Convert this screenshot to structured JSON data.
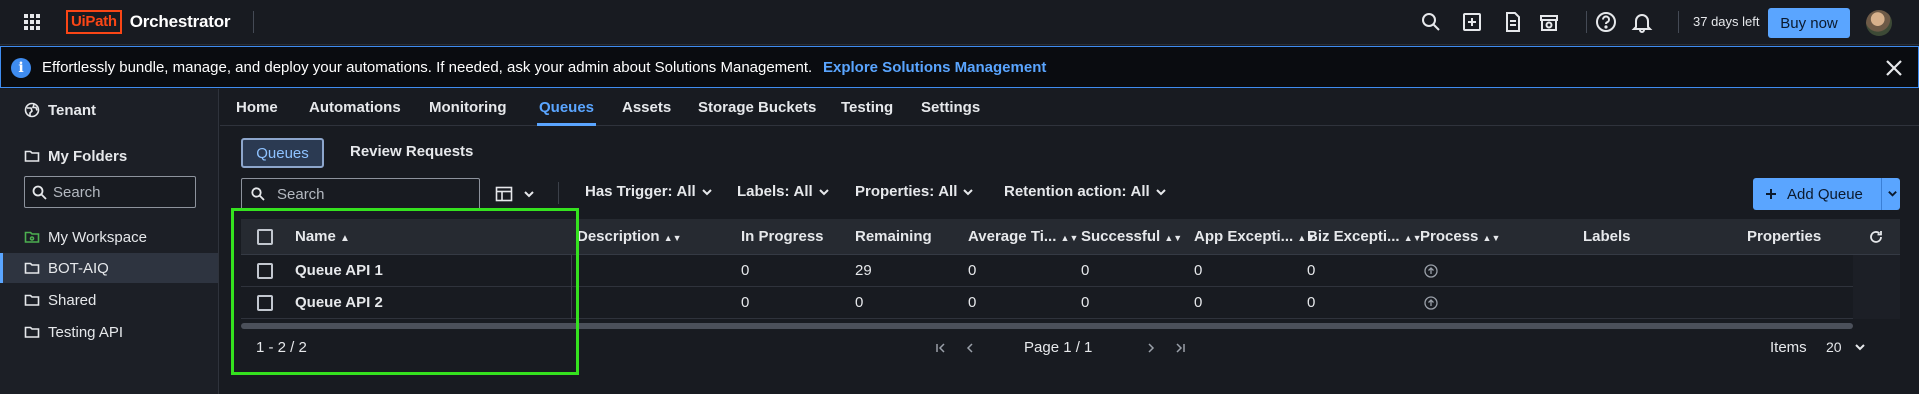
{
  "header": {
    "brand_box": "UiPath",
    "brand_name": "Orchestrator",
    "trial_text": "37 days left",
    "buy_label": "Buy now",
    "icons": [
      "apps-grid-icon",
      "search-icon",
      "add-box-icon",
      "document-icon",
      "store-icon",
      "help-icon",
      "bell-icon"
    ]
  },
  "banner": {
    "message": "Effortlessly bundle, manage, and deploy your automations. If needed, ask your admin about Solutions Management.",
    "link": "Explore Solutions Management"
  },
  "sidebar": {
    "tenant_label": "Tenant",
    "my_folders_label": "My Folders",
    "search_placeholder": "Search",
    "items": [
      {
        "label": "My Workspace",
        "icon": "workspace-folder-icon",
        "color": "#4caf50"
      },
      {
        "label": "BOT-AIQ",
        "icon": "folder-icon",
        "selected": true
      },
      {
        "label": "Shared",
        "icon": "folder-icon"
      },
      {
        "label": "Testing API",
        "icon": "folder-icon"
      }
    ]
  },
  "nav": {
    "tabs": [
      "Home",
      "Automations",
      "Monitoring",
      "Queues",
      "Assets",
      "Storage Buckets",
      "Testing",
      "Settings"
    ],
    "active": "Queues"
  },
  "subtabs": [
    "Queues",
    "Review Requests"
  ],
  "filters": {
    "search_placeholder": "Search",
    "items": [
      {
        "label": "Has Trigger:",
        "value": "All"
      },
      {
        "label": "Labels:",
        "value": "All"
      },
      {
        "label": "Properties:",
        "value": "All"
      },
      {
        "label": "Retention action:",
        "value": "All"
      }
    ],
    "add_button": "Add Queue"
  },
  "table": {
    "columns": [
      "Name",
      "Description",
      "In Progress",
      "Remaining",
      "Average Ti...",
      "Successful",
      "App Excepti...",
      "Biz Excepti...",
      "Process",
      "Labels",
      "Properties"
    ],
    "rows": [
      {
        "name": "Queue API 1",
        "description": "",
        "in_progress": "0",
        "remaining": "29",
        "average_time": "0",
        "successful": "0",
        "app_exceptions": "0",
        "biz_exceptions": "0"
      },
      {
        "name": "Queue API 2",
        "description": "",
        "in_progress": "0",
        "remaining": "0",
        "average_time": "0",
        "successful": "0",
        "app_exceptions": "0",
        "biz_exceptions": "0"
      }
    ]
  },
  "pager": {
    "range": "1 - 2 / 2",
    "page": "Page 1 / 1",
    "items_label": "Items",
    "items_value": "20"
  },
  "colors": {
    "accent": "#5aa5ff",
    "brand": "#fa4616",
    "highlight": "#35e21f",
    "background": "#181b21"
  }
}
